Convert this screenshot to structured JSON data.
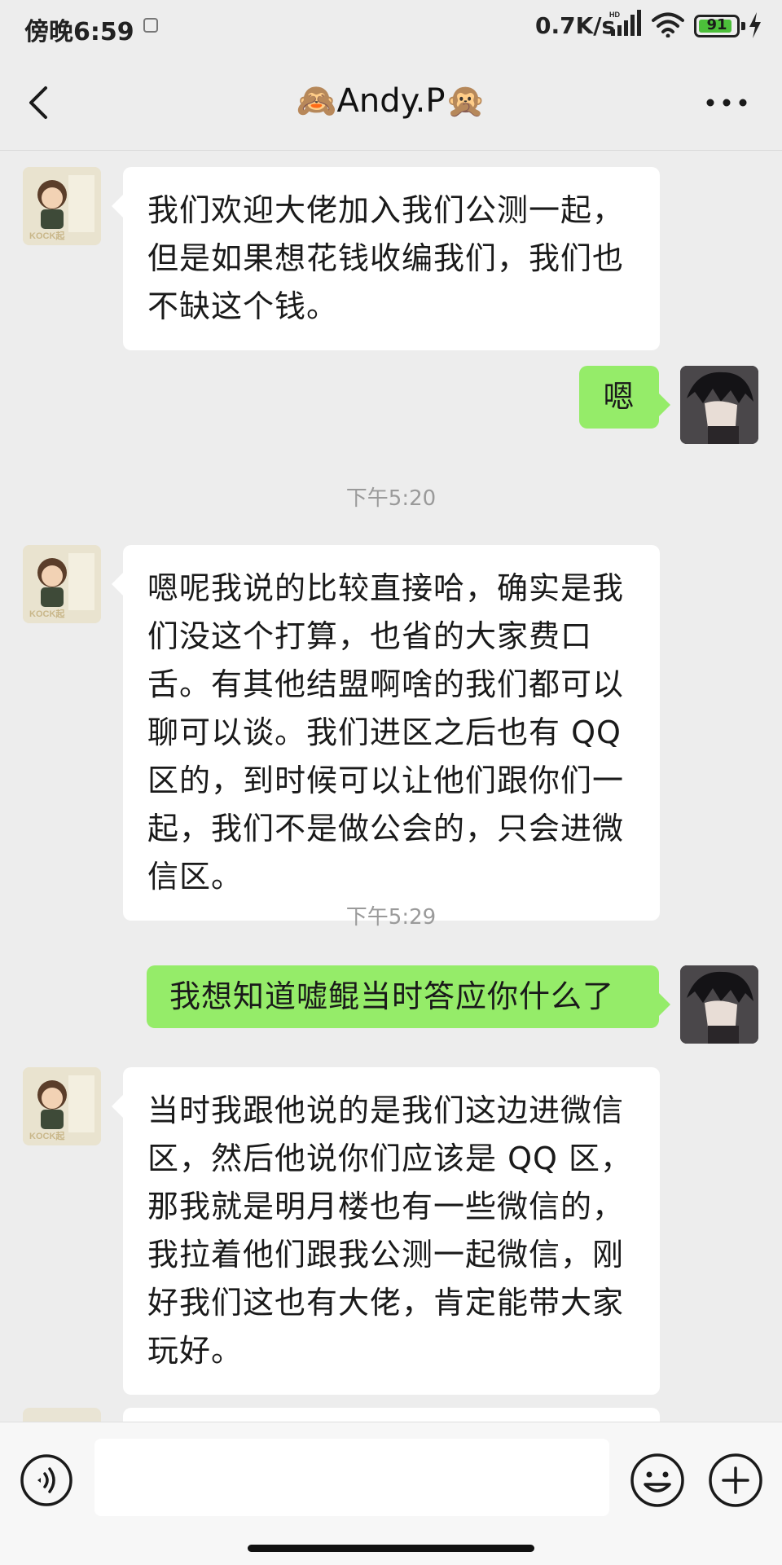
{
  "status_bar": {
    "time": "傍晚6:59",
    "net_speed": "0.7K/s",
    "battery_level": "91",
    "battery_fraction": 0.91,
    "icons": [
      "notification-icon",
      "signal-hd-icon",
      "wifi-icon",
      "battery-icon",
      "charging-icon"
    ]
  },
  "header": {
    "title": "🙈Andy.P🙊",
    "back_icon": "chevron-left-icon",
    "more_icon": "more-dots-icon"
  },
  "messages": [
    {
      "side": "in",
      "text": "我们欢迎大佬加入我们公测一起，但是如果想花钱收编我们，我们也不缺这个钱。"
    },
    {
      "side": "out",
      "text": "嗯"
    },
    {
      "type": "time",
      "text": "下午5:20"
    },
    {
      "side": "in",
      "text": "嗯呢我说的比较直接哈，确实是我们没这个打算，也省的大家费口舌。有其他结盟啊啥的我们都可以聊可以谈。我们进区之后也有 QQ 区的，到时候可以让他们跟你们一起，我们不是做公会的，只会进微信区。"
    },
    {
      "type": "time",
      "text": "下午5:29"
    },
    {
      "side": "out",
      "text": "我想知道嘘鲲当时答应你什么了"
    },
    {
      "side": "in",
      "text": "当时我跟他说的是我们这边进微信区，然后他说你们应该是 QQ 区，那我就是明月楼也有一些微信的，我拉着他们跟我公测一起微信，刚好我们这也有大佬，肯定能带大家玩好。"
    }
  ],
  "input_bar": {
    "text_value": "",
    "icons": [
      "voice-icon",
      "emoji-icon",
      "plus-icon"
    ]
  },
  "colors": {
    "background": "#ededed",
    "outgoing_bubble": "#95ec69",
    "incoming_bubble": "#ffffff",
    "timestamp": "#9a9a9a"
  }
}
